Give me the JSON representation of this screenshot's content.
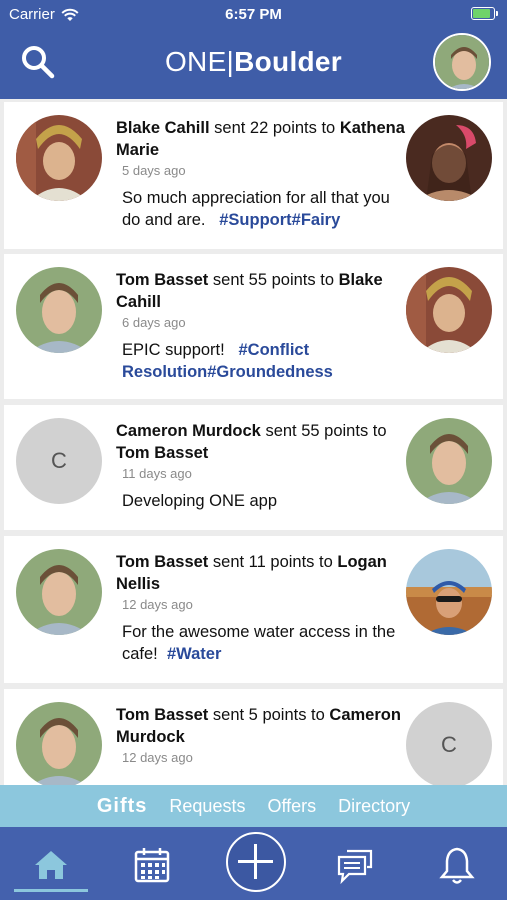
{
  "status_bar": {
    "carrier": "Carrier",
    "time": "6:57 PM"
  },
  "nav": {
    "brand_part1": "ONE",
    "brand_sep": "|",
    "brand_part2": "Boulder"
  },
  "feed": [
    {
      "from": "Blake Cahill",
      "sent_text": "sent 22 points to",
      "to": "Kathena Marie",
      "ago": "5 days ago",
      "message": "So much appreciation for all that you do and are.",
      "tags": "#Support#Fairy"
    },
    {
      "from": "Tom Basset",
      "sent_text": "sent 55 points to",
      "to": "Blake Cahill",
      "ago": "6 days ago",
      "message": "EPIC support!",
      "tags": "#Conflict Resolution#Groundedness"
    },
    {
      "from": "Cameron Murdock",
      "sent_text": "sent 55 points to",
      "to": "Tom Basset",
      "ago": "11 days ago",
      "message": "Developing ONE app",
      "tags": "",
      "left_initial": "C"
    },
    {
      "from": "Tom Basset",
      "sent_text": "sent 11 points to",
      "to": "Logan Nellis",
      "ago": "12 days ago",
      "message": "For the awesome water access in the cafe!",
      "tags": "#Water"
    },
    {
      "from": "Tom Basset",
      "sent_text": "sent 5 points to",
      "to": "Cameron Murdock",
      "ago": "12 days ago",
      "message": "",
      "tags": "",
      "right_initial": "C"
    }
  ],
  "categories": [
    "Gifts",
    "Requests",
    "Offers",
    "Directory"
  ],
  "colors": {
    "primary": "#3f5da8",
    "accent": "#8cc7dd",
    "tag": "#2a4a9a"
  },
  "icons": {
    "nav": [
      "search-icon"
    ],
    "tabbar": [
      "home-icon",
      "calendar-icon",
      "plus-icon",
      "chat-icon",
      "bell-icon"
    ]
  }
}
